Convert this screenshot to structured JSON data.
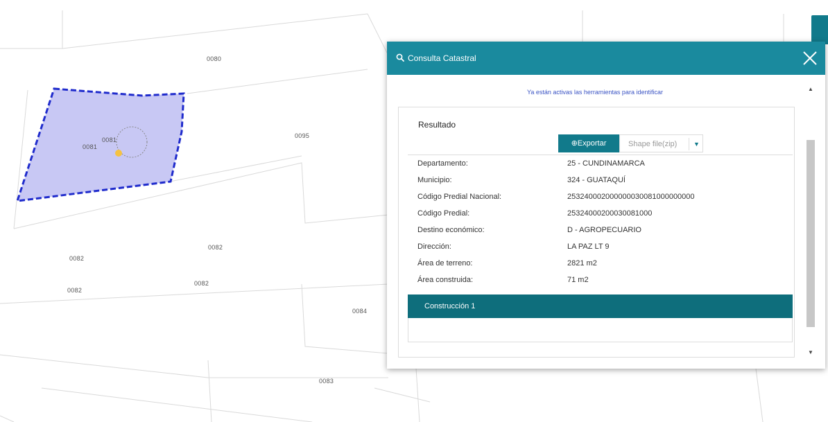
{
  "map": {
    "parcel_labels": [
      "0080",
      "0081",
      "0081",
      "0095",
      "0082",
      "0082",
      "0082",
      "0082",
      "0084",
      "0083"
    ],
    "highlight_fill": "#c8c8f4",
    "highlight_stroke": "#1f2bcc",
    "marker_color": "#f5c242"
  },
  "dialog": {
    "title": "Consulta Catastral",
    "title_icon": "search-icon",
    "close_icon": "close-icon",
    "header_color": "#1a8a9e",
    "info_message": "Ya están activas las herramientas para identificar",
    "result": {
      "title": "Resultado",
      "export_label": "⊕Exportar",
      "format_value": "Shape file(zip)",
      "attributes": [
        {
          "key": "Departamento:",
          "value": "25 - CUNDINAMARCA"
        },
        {
          "key": "Municipio:",
          "value": "324 - GUATAQUÍ"
        },
        {
          "key": "Código Predial Nacional:",
          "value": "253240002000000030081000000000"
        },
        {
          "key": "Código Predial:",
          "value": "25324000200030081000"
        },
        {
          "key": "Destino económico:",
          "value": "D - AGROPECUARIO"
        },
        {
          "key": "Dirección:",
          "value": "LA PAZ LT 9"
        },
        {
          "key": "Área de terreno:",
          "value": "2821 m2"
        },
        {
          "key": "Área construida:",
          "value": "71 m2"
        }
      ],
      "construction_label": "Construcción 1",
      "accent_color": "#117a8b"
    }
  }
}
